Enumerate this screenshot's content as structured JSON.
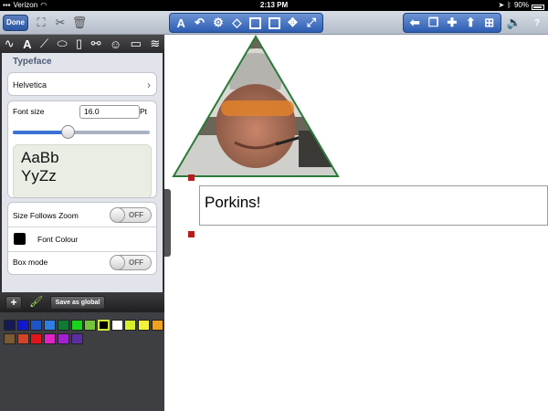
{
  "status_bar": {
    "carrier": "Verizon",
    "time": "2:13 PM",
    "battery": "90%"
  },
  "toolbar": {
    "done_label": "Done",
    "left_icons": [
      "fit-to-screen-icon",
      "scissors-icon",
      "trash-icon"
    ],
    "center_tools": [
      "text-tool-icon",
      "undo-icon",
      "settings-gear-icon",
      "eraser-icon",
      "page-icon",
      "fill-box-icon",
      "move-icon",
      "resize-icon"
    ],
    "right_tools": [
      "back-arrow-icon",
      "copy-pages-icon",
      "add-icon",
      "export-icon",
      "add-page-icon"
    ],
    "speaker_icon": "speaker-icon",
    "help_label": "?"
  },
  "panel": {
    "tool_icons": [
      "curve-tool-icon",
      "text-tool-icon",
      "pen-tool-icon",
      "oval-tool-icon",
      "rectangle-tool-icon",
      "binoculars-icon",
      "smiley-icon",
      "document-icon",
      "layers-icon"
    ],
    "section_title": "Typeface",
    "typeface_value": "Helvetica",
    "font_size_label": "Font size",
    "font_size_value": "16.0",
    "font_size_unit": "Pt",
    "font_size_slider_fraction": 0.4,
    "preview_line1": "AaBb",
    "preview_line2": "YyZz",
    "size_follows_zoom_label": "Size Follows Zoom",
    "size_follows_zoom_state": "OFF",
    "font_colour_label": "Font Colour",
    "font_colour": "#000000",
    "box_mode_label": "Box mode",
    "box_mode_state": "OFF",
    "add_label": "+",
    "save_global_label": "Save as global"
  },
  "palette": {
    "row1": [
      "#151a56",
      "#1118cf",
      "#1e55c7",
      "#2f7ee5",
      "#0e7a33",
      "#16d61a",
      "#76c43a",
      "#000000",
      "#ffffff",
      "#d8f02b",
      "#f3f33a",
      "#f0a21e"
    ],
    "row2": [
      "#7b5b32",
      "#d2442a",
      "#e3151b",
      "#e322c7",
      "#a31fd6",
      "#5b2ea3"
    ],
    "selected_index": 7
  },
  "canvas": {
    "text_box_value": "Porkins!"
  }
}
